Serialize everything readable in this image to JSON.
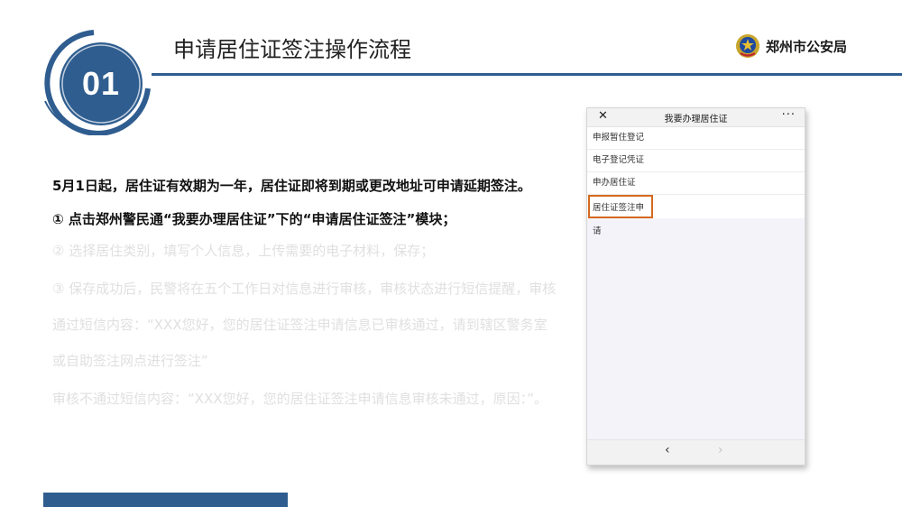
{
  "header": {
    "number": "01",
    "title": "申请居住证签注操作流程",
    "org_name": "郑州市公安局"
  },
  "content": {
    "para1": "5月1日起，居住证有效期为一年，居住证即将到期或更改地址可申请延期签注。",
    "step1": "① 点击郑州警民通“我要办理居住证”下的“申请居住证签注”模块；",
    "step2": "② 选择居住类别，填写个人信息，上传需要的电子材料，保存；",
    "step3": "③ 保存成功后，民警将在五个工作日对信息进行审核，审核状态进行短信提醒，审核通过短信内容：“XXX您好，您的居住证签注申请信息已审核通过，请到辖区警务室或自助签注网点进行签注”",
    "step4": "审核不通过短信内容：“XXX您好，您的居住证签注申请信息审核未通过，原因：”。"
  },
  "phone": {
    "close_glyph": "✕",
    "title": "我要办理居住证",
    "more_glyph": "···",
    "menu": [
      "申报暂住登记",
      "电子登记凭证",
      "申办居住证",
      "居住证签注申请"
    ],
    "back_glyph": "‹",
    "forward_glyph": "›"
  },
  "colors": {
    "accent_blue": "#2f5d8f",
    "highlight_orange": "#d4691f"
  }
}
